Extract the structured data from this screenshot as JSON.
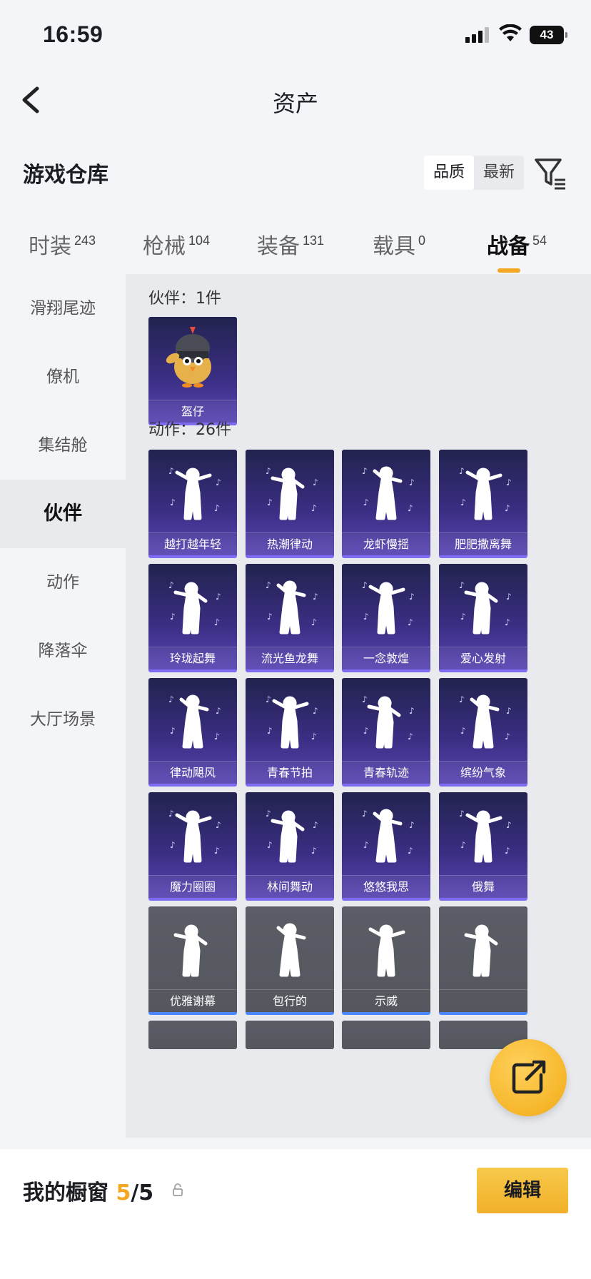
{
  "status_bar": {
    "time": "16:59",
    "battery": "43"
  },
  "nav": {
    "title": "资产"
  },
  "section": {
    "heading": "游戏仓库",
    "sort_options": [
      "品质",
      "最新"
    ]
  },
  "tabs": [
    {
      "label": "时装",
      "count": "243"
    },
    {
      "label": "枪械",
      "count": "104"
    },
    {
      "label": "装备",
      "count": "131"
    },
    {
      "label": "载具",
      "count": "0"
    },
    {
      "label": "战备",
      "count": "54"
    }
  ],
  "sidebar": [
    "滑翔尾迹",
    "僚机",
    "集结舱",
    "伙伴",
    "动作",
    "降落伞",
    "大厅场景"
  ],
  "partner_group": {
    "title": "伙伴：1件",
    "items": [
      "盔仔"
    ]
  },
  "action_group": {
    "title": "动作：26件",
    "items": [
      "越打越年轻",
      "热潮律动",
      "龙虾慢摇",
      "肥肥撒离舞",
      "玲珑起舞",
      "流光鱼龙舞",
      "一念敦煌",
      "爱心发射",
      "律动飓风",
      "青春节拍",
      "青春轨迹",
      "缤纷气象",
      "魔力圈圈",
      "林间舞动",
      "悠悠我思",
      "俄舞",
      "优雅谢幕",
      "包行的",
      "示威",
      ""
    ]
  },
  "bottom": {
    "label": "我的橱窗",
    "current": "5",
    "total": "/5",
    "edit": "编辑"
  },
  "colors": {
    "accent": "#f5a623",
    "card_purple": "#3a2e83",
    "card_grey": "#55575f"
  }
}
